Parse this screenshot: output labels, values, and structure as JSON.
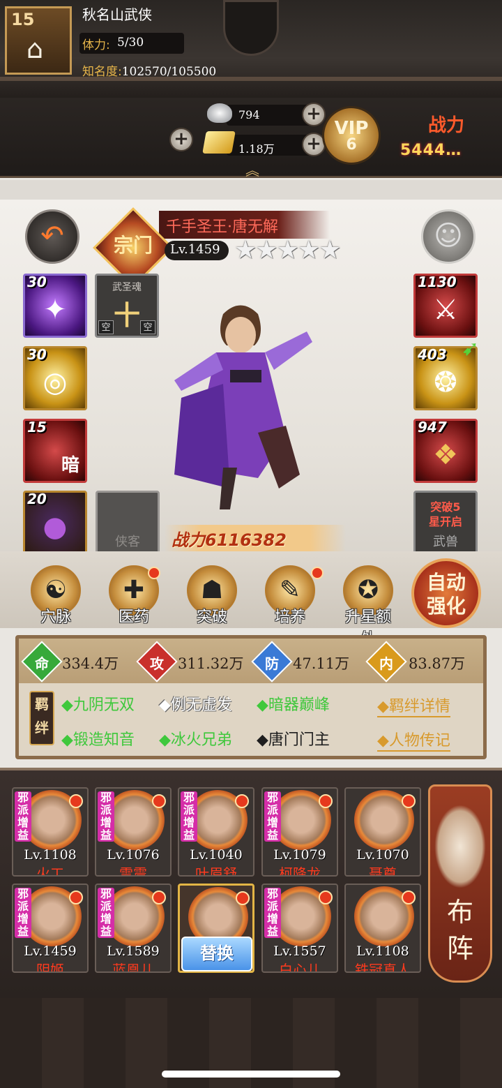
{
  "player": {
    "level": "15",
    "name": "秋名山武侠",
    "stamina_label": "体力:",
    "stamina_value": "5/30",
    "fame_label": "知名度:",
    "fame_value": "102570/105500"
  },
  "currency": {
    "silver": "794",
    "gold": "1.18万"
  },
  "vip": {
    "label": "VIP",
    "level": "6"
  },
  "top_power": {
    "label": "战力",
    "value": "5444…"
  },
  "hero": {
    "sect": "宗门",
    "title": "千手圣王·唐无解",
    "level": "Lv.1459",
    "stars": 5,
    "power": "战力6116382"
  },
  "left_slots": [
    {
      "num": "30",
      "type": "purple-skill"
    },
    {
      "num": "30",
      "type": "gold-skill"
    },
    {
      "num": "15",
      "type": "red-skill",
      "text": "暗"
    },
    {
      "num": "20",
      "type": "orb"
    }
  ],
  "soul_slot": {
    "label": "武圣魂",
    "char": "十",
    "corner_left": "空",
    "corner_right": "空"
  },
  "helper_slot": {
    "label": "侠客"
  },
  "right_slots": [
    {
      "num": "1130",
      "type": "weapon"
    },
    {
      "num": "403",
      "type": "tiger"
    },
    {
      "num": "947",
      "type": "armor"
    }
  ],
  "beast_slot": {
    "line1": "突破5",
    "line2": "星开启",
    "label": "武兽"
  },
  "actions": [
    "穴脉",
    "医药",
    "突破",
    "培养",
    "升星额外"
  ],
  "auto_button": {
    "line1": "自动",
    "line2": "强化"
  },
  "stats": [
    {
      "icon": "命",
      "value": "334.4万",
      "color": "#37a93a"
    },
    {
      "icon": "攻",
      "value": "311.32万",
      "color": "#c9302c"
    },
    {
      "icon": "防",
      "value": "47.11万",
      "color": "#3a7ad6"
    },
    {
      "icon": "内",
      "value": "83.87万",
      "color": "#d99a1c"
    }
  ],
  "bond_tag": "羁绊",
  "bonds": [
    {
      "text": "◆九阴无双",
      "style": "active"
    },
    {
      "text": "◆例无虚发",
      "style": "white"
    },
    {
      "text": "◆暗器巅峰",
      "style": "active"
    },
    {
      "text": "◆锻造知音",
      "style": "active"
    },
    {
      "text": "◆冰火兄弟",
      "style": "active"
    },
    {
      "text": "◆唐门门主",
      "style": "inactive"
    }
  ],
  "links": {
    "bond_detail": "◆羁绊详情",
    "biography": "◆人物传记"
  },
  "team": [
    {
      "level": "Lv.1108",
      "name": "火工",
      "evil": true
    },
    {
      "level": "Lv.1076",
      "name": "雷震",
      "evil": true
    },
    {
      "level": "Lv.1040",
      "name": "叶眉舒",
      "evil": true
    },
    {
      "level": "Lv.1079",
      "name": "柯降龙",
      "evil": true
    },
    {
      "level": "Lv.1070",
      "name": "聂尊",
      "evil": false
    },
    {
      "level": "Lv.1459",
      "name": "阴姬",
      "evil": true
    },
    {
      "level": "Lv.1589",
      "name": "蓝凰儿",
      "evil": true
    },
    {
      "level": "",
      "name": "",
      "evil": false
    },
    {
      "level": "Lv.1557",
      "name": "白心儿",
      "evil": true
    },
    {
      "level": "Lv.1108",
      "name": "铁冠真人",
      "evil": false
    }
  ],
  "evil_tag": "邪派增益",
  "swap_button": "替换",
  "formation_button": {
    "line1": "布",
    "line2": "阵"
  }
}
